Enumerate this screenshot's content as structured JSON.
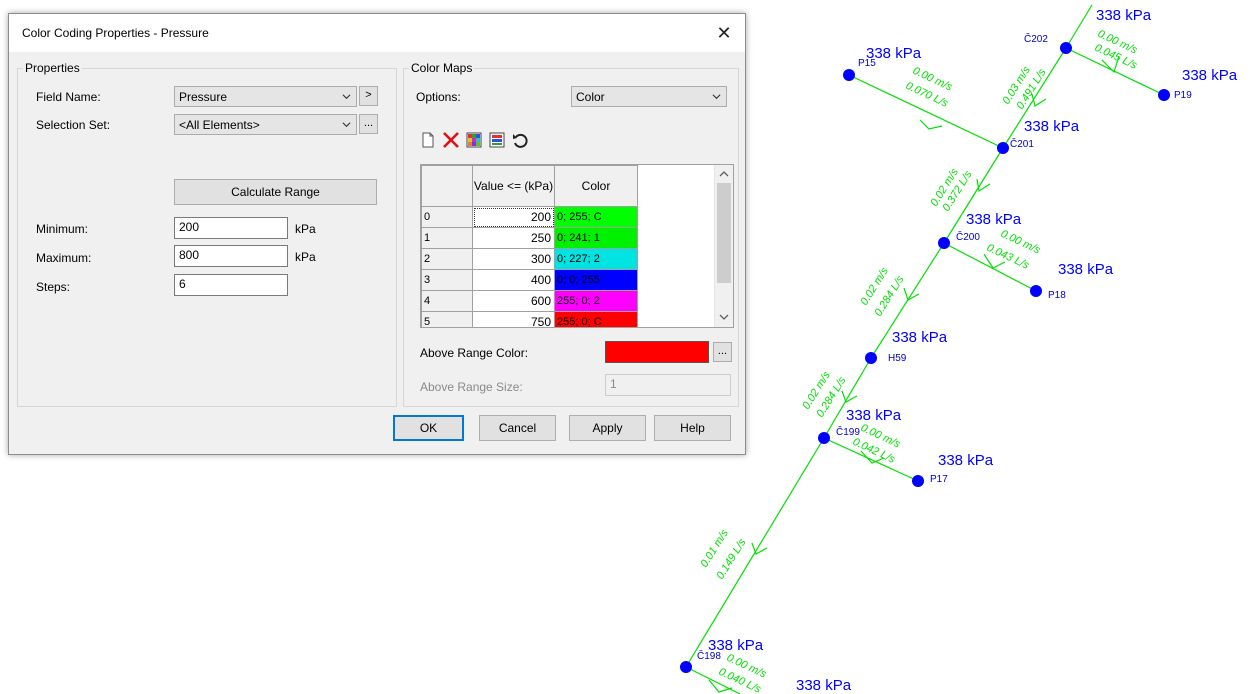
{
  "dialog": {
    "title": "Color Coding Properties - Pressure",
    "properties_group": "Properties",
    "field_name_label": "Field Name:",
    "field_name_value": "Pressure",
    "field_name_button": ">",
    "selection_set_label": "Selection Set:",
    "selection_set_value": "<All Elements>",
    "selection_set_button": "...",
    "calculate_range_label": "Calculate Range",
    "minimum_label": "Minimum:",
    "minimum_value": "200",
    "minimum_unit": "kPa",
    "maximum_label": "Maximum:",
    "maximum_value": "800",
    "maximum_unit": "kPa",
    "steps_label": "Steps:",
    "steps_value": "6",
    "color_maps_group": "Color Maps",
    "options_label": "Options:",
    "options_value": "Color",
    "table": {
      "header_value": "Value <= (kPa)",
      "header_color": "Color",
      "rows": [
        {
          "index": "0",
          "value": "200",
          "color_text": "0; 255; C",
          "color": "#00ff00"
        },
        {
          "index": "1",
          "value": "250",
          "color_text": "0; 241; 1",
          "color": "#00f100"
        },
        {
          "index": "2",
          "value": "300",
          "color_text": "0; 227; 2",
          "color": "#00e3e3"
        },
        {
          "index": "3",
          "value": "400",
          "color_text": "0; 0; 255",
          "color": "#0000ff"
        },
        {
          "index": "4",
          "value": "600",
          "color_text": "255; 0; 2",
          "color": "#ff00ff"
        },
        {
          "index": "5",
          "value": "750",
          "color_text": "255; 0; C",
          "color": "#ff0000"
        }
      ]
    },
    "above_range_color_label": "Above Range Color:",
    "above_range_color": "#ff0000",
    "above_range_color_button": "...",
    "above_range_size_label": "Above Range Size:",
    "above_range_size_value": "1",
    "ok_label": "OK",
    "cancel_label": "Cancel",
    "apply_label": "Apply",
    "help_label": "Help",
    "close_symbol": "✕"
  },
  "network": {
    "pipe_color": "#00e000",
    "node_color": "#0000ff",
    "nodes": [
      {
        "id": "P15",
        "pressure": "338 kPa"
      },
      {
        "id": "Č202",
        "pressure": "338 kPa"
      },
      {
        "id": "P19",
        "pressure": "338 kPa"
      },
      {
        "id": "Č201",
        "pressure": "338 kPa"
      },
      {
        "id": "Č200",
        "pressure": "338 kPa"
      },
      {
        "id": "P18",
        "pressure": "338 kPa"
      },
      {
        "id": "H59",
        "pressure": "338 kPa"
      },
      {
        "id": "Č199",
        "pressure": "338 kPa"
      },
      {
        "id": "P17",
        "pressure": "338 kPa"
      },
      {
        "id": "Č198",
        "pressure": "338 kPa"
      },
      {
        "id": "",
        "pressure": "338 kPa"
      },
      {
        "id": "",
        "pressure": "338 kPa"
      }
    ],
    "pipes": [
      {
        "velocity": "0.00 m/s",
        "flow": "0.070 L/s"
      },
      {
        "velocity": "0.03 m/s",
        "flow": "0.491 L/s"
      },
      {
        "velocity": "0.00 m/s",
        "flow": "0.045 L/s"
      },
      {
        "velocity": "0.02 m/s",
        "flow": "0.372 L/s"
      },
      {
        "velocity": "0.00 m/s",
        "flow": "0.043 L/s"
      },
      {
        "velocity": "0.02 m/s",
        "flow": "0.284 L/s"
      },
      {
        "velocity": "0.02 m/s",
        "flow": "0.284 L/s"
      },
      {
        "velocity": "0.00 m/s",
        "flow": "0.042 L/s"
      },
      {
        "velocity": "0.01 m/s",
        "flow": "0.149 L/s"
      },
      {
        "velocity": "0.00 m/s",
        "flow": "0.040 L/s"
      }
    ]
  }
}
